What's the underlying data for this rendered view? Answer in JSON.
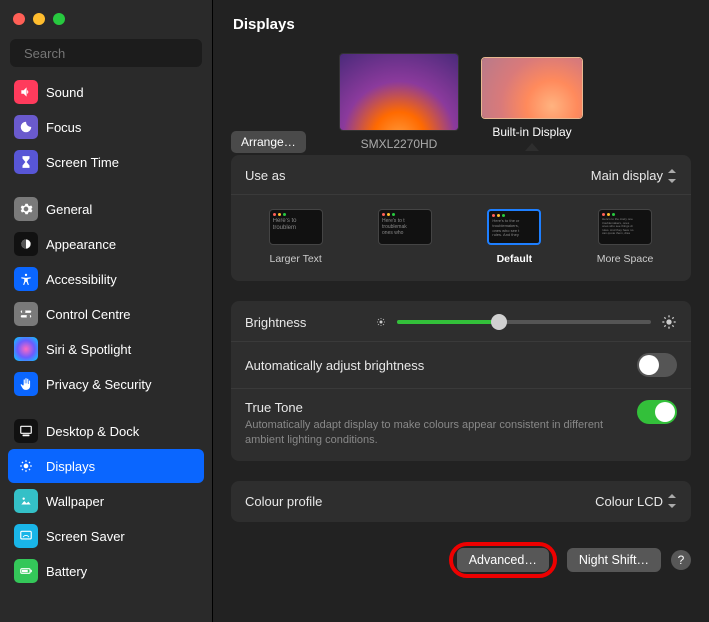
{
  "search": {
    "placeholder": "Search"
  },
  "sidebar": {
    "items": [
      {
        "label": "Sound",
        "icon": "speaker",
        "bg": "#ff3b5c"
      },
      {
        "label": "Focus",
        "icon": "moon",
        "bg": "#6a5acd"
      },
      {
        "label": "Screen Time",
        "icon": "hourglass",
        "bg": "#5856d6"
      }
    ],
    "items2": [
      {
        "label": "General",
        "icon": "gear",
        "bg": "#7a7a7a"
      },
      {
        "label": "Appearance",
        "icon": "appearance",
        "bg": "#111"
      },
      {
        "label": "Accessibility",
        "icon": "accessibility",
        "bg": "#0a66ff"
      },
      {
        "label": "Control Centre",
        "icon": "switches",
        "bg": "#7a7a7a"
      },
      {
        "label": "Siri & Spotlight",
        "icon": "siri",
        "bg": "#111"
      },
      {
        "label": "Privacy & Security",
        "icon": "hand",
        "bg": "#0a66ff"
      }
    ],
    "items3": [
      {
        "label": "Desktop & Dock",
        "icon": "dock",
        "bg": "#111"
      },
      {
        "label": "Displays",
        "icon": "sun",
        "bg": "#0a66ff",
        "selected": true
      },
      {
        "label": "Wallpaper",
        "icon": "wallpaper",
        "bg": "#34c0c7"
      },
      {
        "label": "Screen Saver",
        "icon": "screensaver",
        "bg": "#19b5e8"
      },
      {
        "label": "Battery",
        "icon": "battery",
        "bg": "#34c759"
      }
    ]
  },
  "header": {
    "title": "Displays"
  },
  "arrange_label": "Arrange…",
  "displays": [
    {
      "name": "SMXL2270HD",
      "selected": false
    },
    {
      "name": "Built-in Display",
      "selected": true
    }
  ],
  "use_as": {
    "label": "Use as",
    "value": "Main display"
  },
  "scaling": {
    "options": [
      {
        "label": "Larger Text",
        "selected": false
      },
      {
        "label": "",
        "selected": false
      },
      {
        "label": "Default",
        "selected": true
      },
      {
        "label": "More Space",
        "selected": false
      }
    ],
    "sample": "Here's to the crazy ones, troublemakers, ones who see things rules. And they"
  },
  "brightness": {
    "label": "Brightness",
    "value": 0.4
  },
  "auto_brightness": {
    "label": "Automatically adjust brightness",
    "on": false
  },
  "true_tone": {
    "label": "True Tone",
    "desc": "Automatically adapt display to make colours appear consistent in different ambient lighting conditions.",
    "on": true
  },
  "colour_profile": {
    "label": "Colour profile",
    "value": "Colour LCD"
  },
  "footer": {
    "advanced": "Advanced…",
    "night_shift": "Night Shift…",
    "help": "?"
  }
}
